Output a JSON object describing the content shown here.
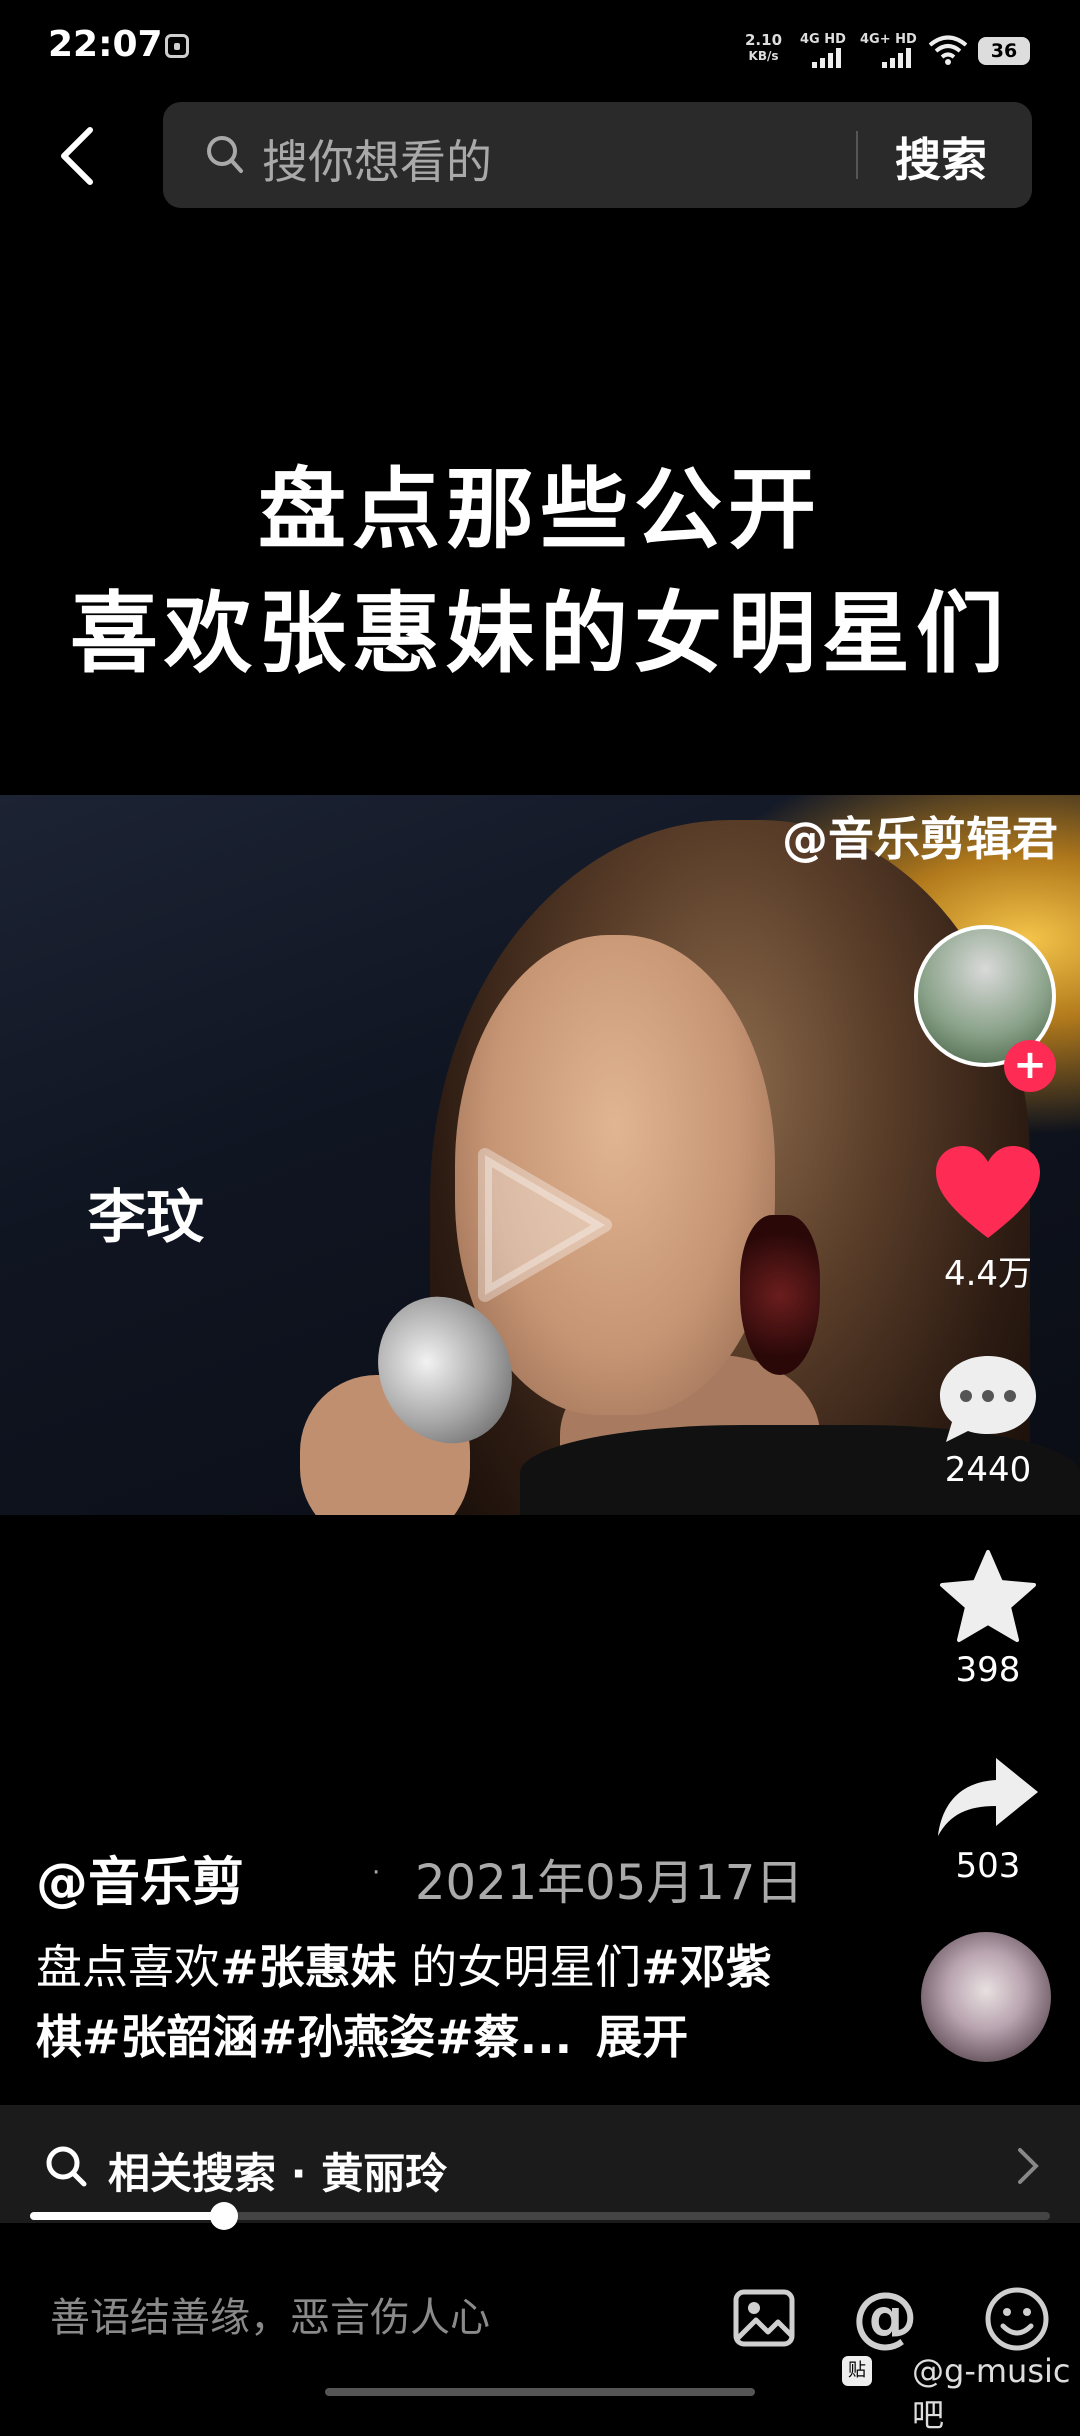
{
  "status_bar": {
    "time": "22:07",
    "net_speed": "2.10",
    "net_unit": "KB/s",
    "signal1": "4G HD",
    "signal2": "4G+ HD",
    "battery": "36"
  },
  "top_bar": {
    "search_placeholder": "搜你想看的",
    "search_button": "搜索"
  },
  "video": {
    "headline_line1": "盘点那些公开",
    "headline_line2": "喜欢张惠妹的女明星们",
    "name_overlay": "李玟",
    "watermark": "@音乐剪辑君"
  },
  "actions": {
    "likes": "4.4万",
    "comments": "2440",
    "favorites": "398",
    "shares": "503",
    "follow_symbol": "+"
  },
  "post": {
    "author": "@音乐剪",
    "dot": "·",
    "date": "2021年05月17日",
    "caption_plain1": "盘点喜欢",
    "caption_tag1": "#张惠妹",
    "caption_plain2": " 的女明星们",
    "caption_tag2": "#邓紫棋#张韶涵#孙燕姿#蔡...",
    "expand": "展开"
  },
  "related_search": {
    "label": "相关搜索 · 黄丽玲"
  },
  "progress": {
    "played_fraction": 0.19
  },
  "comment_bar": {
    "placeholder": "善语结善缘，恶言伤人心",
    "at_symbol": "@"
  },
  "source_mark": {
    "badge": "贴",
    "text": "@g-music吧"
  },
  "colors": {
    "accent_red": "#fe2c55",
    "background": "#000000",
    "panel": "#1b1b1b"
  }
}
